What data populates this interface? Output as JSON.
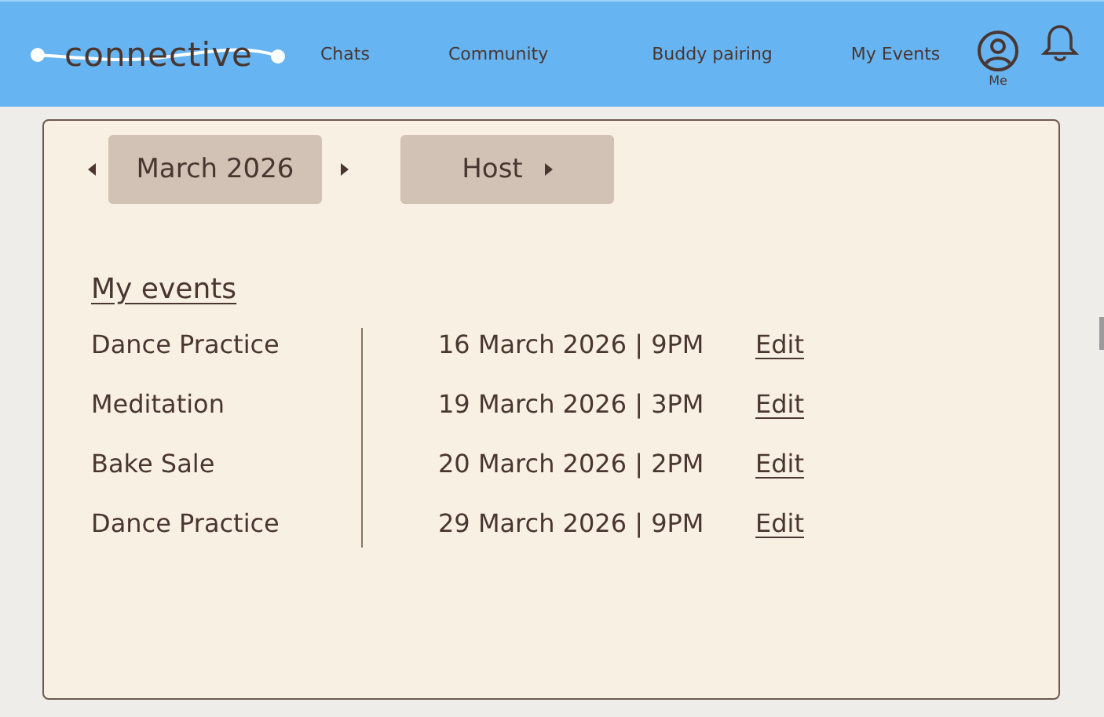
{
  "header": {
    "logo": "connective",
    "nav": [
      {
        "label": "Chats",
        "selected": false
      },
      {
        "label": "Community",
        "selected": false
      },
      {
        "label": "Buddy pairing",
        "selected": false
      },
      {
        "label": "My Events",
        "selected": false
      }
    ],
    "profile_label": "Me"
  },
  "month_picker": {
    "label": "March 2026"
  },
  "host_button": {
    "label": "Host"
  },
  "events_heading": "My events",
  "events": [
    {
      "name": "Dance Practice",
      "when": "16 March 2026 | 9PM",
      "action": "Edit"
    },
    {
      "name": "Meditation",
      "when": "19 March 2026 | 3PM",
      "action": "Edit"
    },
    {
      "name": "Bake Sale",
      "when": "20 March 2026 | 2PM",
      "action": "Edit"
    },
    {
      "name": "Dance Practice",
      "when": "29 March 2026 | 9PM",
      "action": "Edit"
    }
  ]
}
